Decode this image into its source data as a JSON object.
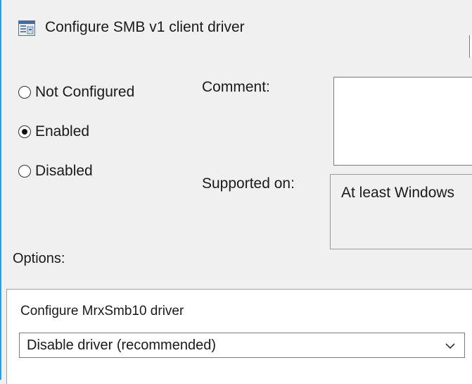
{
  "window": {
    "title": "Configure SMB v1 client driver",
    "icon": "policy-setting-icon"
  },
  "state": {
    "options": [
      {
        "label": "Not Configured",
        "checked": false
      },
      {
        "label": "Enabled",
        "checked": true
      },
      {
        "label": "Disabled",
        "checked": false
      }
    ]
  },
  "comment": {
    "label": "Comment:",
    "value": ""
  },
  "supported": {
    "label": "Supported on:",
    "value": "At least Windows"
  },
  "options_section": {
    "label": "Options:",
    "setting_label": "Configure MrxSmb10 driver",
    "dropdown_value": "Disable driver (recommended)",
    "dropdown_icon": "chevron-down-icon"
  },
  "colors": {
    "accent": "#2e9fd8",
    "background": "#f0f0f0"
  }
}
